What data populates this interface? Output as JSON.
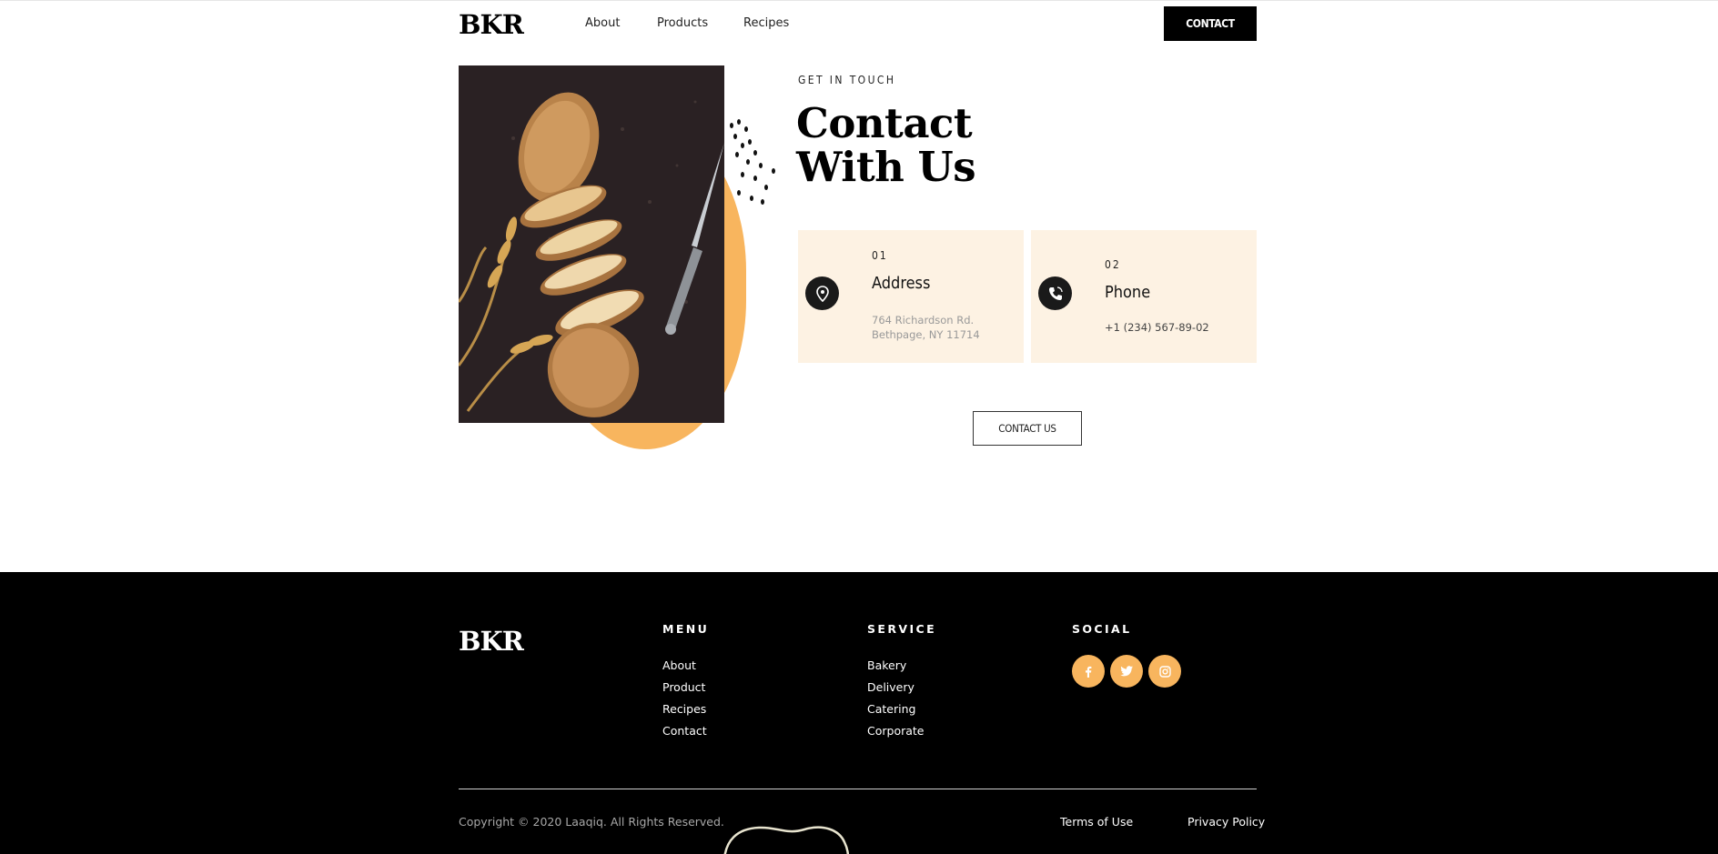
{
  "header": {
    "logo": "BKR",
    "nav": [
      "About",
      "Products",
      "Recipes"
    ],
    "contact_label": "CONTACT"
  },
  "hero": {
    "image_alt": "Sliced baguette with a knife and wheat stalks",
    "eyebrow": "GET IN TOUCH",
    "title_line1": "Contact",
    "title_line2": "With Us"
  },
  "cards": [
    {
      "num": "01",
      "title": "Address",
      "icon": "location-pin-icon",
      "lines": [
        "764 Richardson Rd.",
        "Bethpage, NY 11714"
      ]
    },
    {
      "num": "02",
      "title": "Phone",
      "icon": "phone-icon",
      "lines": [
        "+1 (234) 567-89-02"
      ]
    }
  ],
  "contact_us_label": "CONTACT US",
  "footer": {
    "logo": "BKR",
    "menu": {
      "heading": "MENU",
      "items": [
        "About",
        "Product",
        "Recipes",
        "Contact"
      ]
    },
    "service": {
      "heading": "SERVICE",
      "items": [
        "Bakery",
        "Delivery",
        "Catering",
        "Corporate"
      ]
    },
    "social": {
      "heading": "SOCIAL",
      "icons": [
        "facebook-icon",
        "twitter-icon",
        "instagram-icon"
      ]
    },
    "copyright": "Copyright © 2020 Laaqiq. All Rights Reserved.",
    "terms": "Terms of Use",
    "privacy": "Privacy Policy"
  },
  "colors": {
    "accent": "#f8b55e",
    "card_bg": "#fdf2e3",
    "footer_bg": "#000000"
  }
}
